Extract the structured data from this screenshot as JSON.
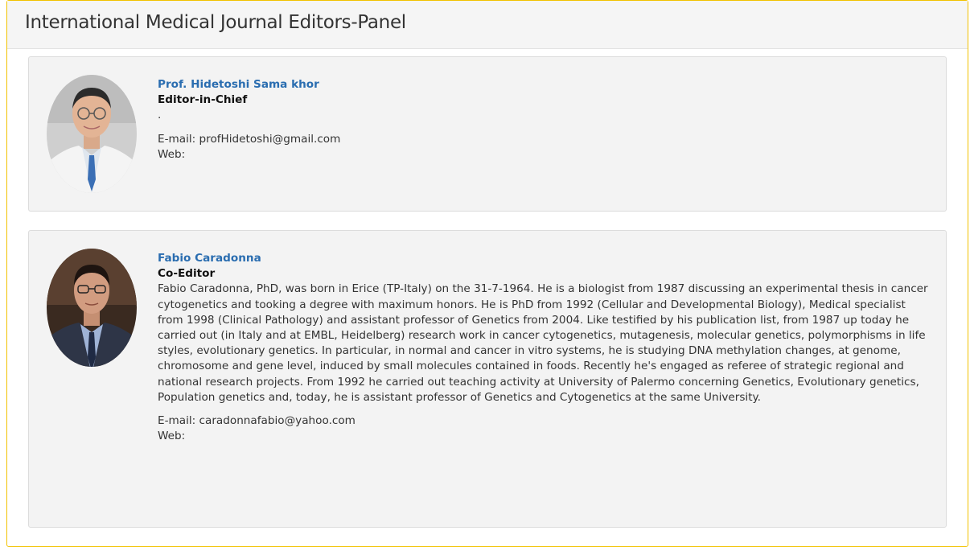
{
  "panel": {
    "title": "International Medical Journal Editors-Panel"
  },
  "editors": [
    {
      "name": "Prof. Hidetoshi Sama khor",
      "role": "Editor-in-Chief",
      "bio": ".",
      "email": "E-mail: profHidetoshi@gmail.com",
      "web": "Web:"
    },
    {
      "name": "Fabio Caradonna",
      "role": "Co-Editor",
      "bio": "Fabio Caradonna, PhD, was born in Erice (TP-Italy) on the 31-7-1964. He is a biologist from 1987 discussing an experimental thesis in cancer cytogenetics and tooking a degree with maximum honors. He is PhD from 1992 (Cellular and Developmental Biology), Medical specialist from 1998 (Clinical Pathology) and assistant professor of Genetics from 2004. Like testified by his publication list, from 1987 up today he carried out (in Italy and at EMBL, Heidelberg) research work in cancer cytogenetics, mutagenesis, molecular genetics, polymorphisms in life styles, evolutionary genetics. In particular, in normal and cancer in vitro systems, he is studying DNA methylation changes, at genome, chromosome and gene level, induced by small molecules contained in foods. Recently he's engaged as referee of strategic regional and national research projects. From 1992 he carried out teaching activity at University of Palermo concerning Genetics, Evolutionary genetics, Population genetics and, today, he is assistant professor of Genetics and Cytogenetics at the same University.",
      "email": "E-mail: caradonnafabio@yahoo.com",
      "web": "Web:"
    }
  ]
}
